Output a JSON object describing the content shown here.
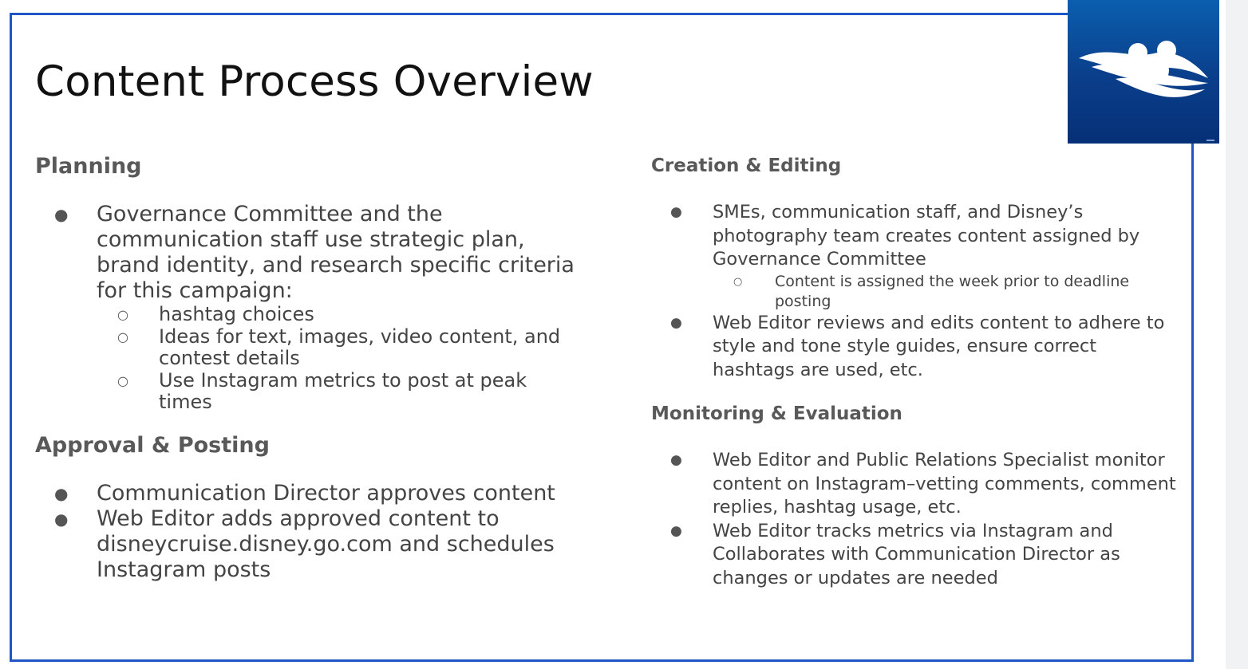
{
  "slide": {
    "title": "Content Process Overview",
    "logo_icon": "disney-cruise-line-logo-icon",
    "colors": {
      "frame": "#1f56c6",
      "logo_bg": "#0a3e8a",
      "heading": "#595959",
      "body": "#444444"
    }
  },
  "left": {
    "planning": {
      "heading": "Planning",
      "bullets": [
        {
          "text": "Governance Committee and the communication staff use strategic plan, brand identity, and research specific criteria for this campaign:",
          "sub": [
            "hashtag choices",
            "Ideas for text, images, video content, and contest details",
            "Use Instagram metrics to post at peak times"
          ]
        }
      ]
    },
    "approval": {
      "heading": "Approval & Posting",
      "bullets": [
        "Communication Director approves content",
        "Web Editor adds approved content to disneycruise.disney.go.com and schedules Instagram posts"
      ]
    }
  },
  "right": {
    "creation": {
      "heading": "Creation & Editing",
      "bullets": [
        {
          "text": "SMEs, communication staff, and Disney’s photography team creates content assigned by Governance Committee",
          "sub": [
            "Content is assigned the week prior to deadline posting"
          ]
        },
        {
          "text": "Web Editor reviews and edits content to adhere to style and tone style guides, ensure correct hashtags are used, etc."
        }
      ]
    },
    "monitoring": {
      "heading": "Monitoring & Evaluation",
      "bullets": [
        "Web Editor and Public Relations Specialist monitor content on Instagram–vetting comments, comment replies, hashtag usage, etc.",
        "Web Editor tracks metrics via Instagram and Collaborates with Communication Director as changes or updates are needed"
      ]
    }
  }
}
